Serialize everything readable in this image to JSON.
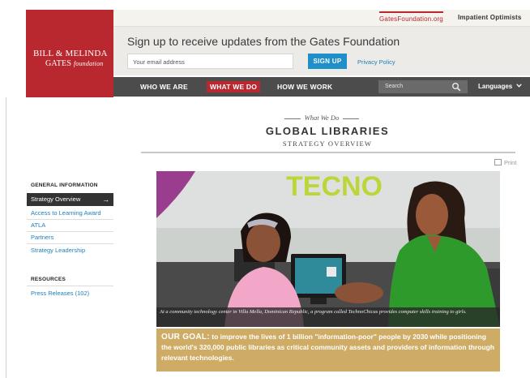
{
  "topbar": {
    "link_foundation": "GatesFoundation.org",
    "link_optimists": "Impatient Optimists"
  },
  "logo": {
    "line1": "BILL & MELINDA",
    "line2": "GATES",
    "line2_suffix": "foundation"
  },
  "signup": {
    "title": "Sign up to receive updates from the Gates Foundation",
    "email_placeholder": "Your email address",
    "button": "SIGN UP",
    "privacy": "Privacy Policy"
  },
  "nav": {
    "items": [
      {
        "label": "WHO WE ARE",
        "active": false
      },
      {
        "label": "WHAT WE DO",
        "active": true
      },
      {
        "label": "HOW WE WORK",
        "active": false
      }
    ],
    "search_placeholder": "Search",
    "languages": "Languages"
  },
  "header": {
    "kicker": "What We Do",
    "title": "GLOBAL LIBRARIES",
    "subtitle": "STRATEGY OVERVIEW",
    "print": "Print"
  },
  "sidebar": {
    "general_heading": "GENERAL INFORMATION",
    "items": [
      {
        "label": "Strategy Overview",
        "active": true
      },
      {
        "label": "Access to Learning Award",
        "active": false
      },
      {
        "label": "ATLA",
        "active": false
      },
      {
        "label": "Partners",
        "active": false
      },
      {
        "label": "Strategy Leadership",
        "active": false
      }
    ],
    "resources_heading": "RESOURCES",
    "resources": [
      {
        "label": "Press Releases (102)"
      }
    ]
  },
  "main": {
    "photo_wall_text": "TECNO",
    "caption": "At a community technology center in Villa Mella, Dominican Republic, a program called TechnoChicas provides computer skills training to girls.",
    "goal_label": "OUR GOAL:",
    "goal_text": "to improve the lives of 1 billion \"information-poor\" people by 2030 while positioning the world's 320,000 public libraries as critical community assets and providers of information through relevant technologies."
  },
  "colors": {
    "brand_red": "#b8282e",
    "nav_dark": "#4c4c4c",
    "link_blue": "#1e7fb8",
    "signup_button": "#1e8fc8",
    "goal_gold": "#cfac66"
  }
}
